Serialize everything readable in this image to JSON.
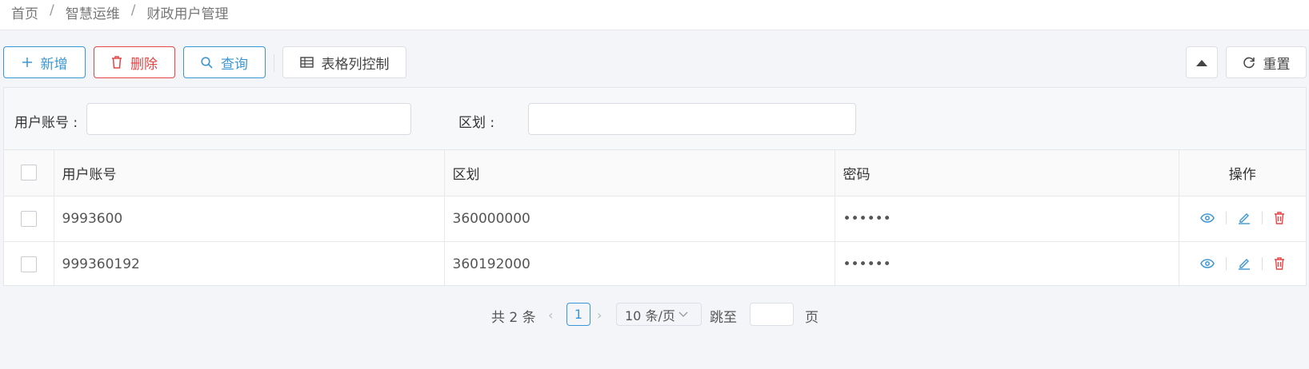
{
  "breadcrumb": [
    "首页",
    "智慧运维",
    "财政用户管理"
  ],
  "breadcrumb_separator": "/",
  "toolbar": {
    "add_label": "新增",
    "delete_label": "删除",
    "query_label": "查询",
    "columns_label": "表格列控制",
    "reset_label": "重置"
  },
  "search": {
    "account_label": "用户账号 :",
    "account_value": "",
    "region_label": "区划 :",
    "region_value": ""
  },
  "table": {
    "headers": [
      "用户账号",
      "区划",
      "密码",
      "操作"
    ],
    "rows": [
      {
        "account": "9993600",
        "region": "360000000",
        "password": "••••••"
      },
      {
        "account": "999360192",
        "region": "360192000",
        "password": "••••••"
      }
    ]
  },
  "pager": {
    "total": "共 2 条",
    "current_page": "1",
    "page_size": "10 条/页",
    "jump_label": "跳至",
    "page_suffix": "页"
  },
  "colors": {
    "primary": "#3b97d3",
    "danger": "#e64545"
  }
}
